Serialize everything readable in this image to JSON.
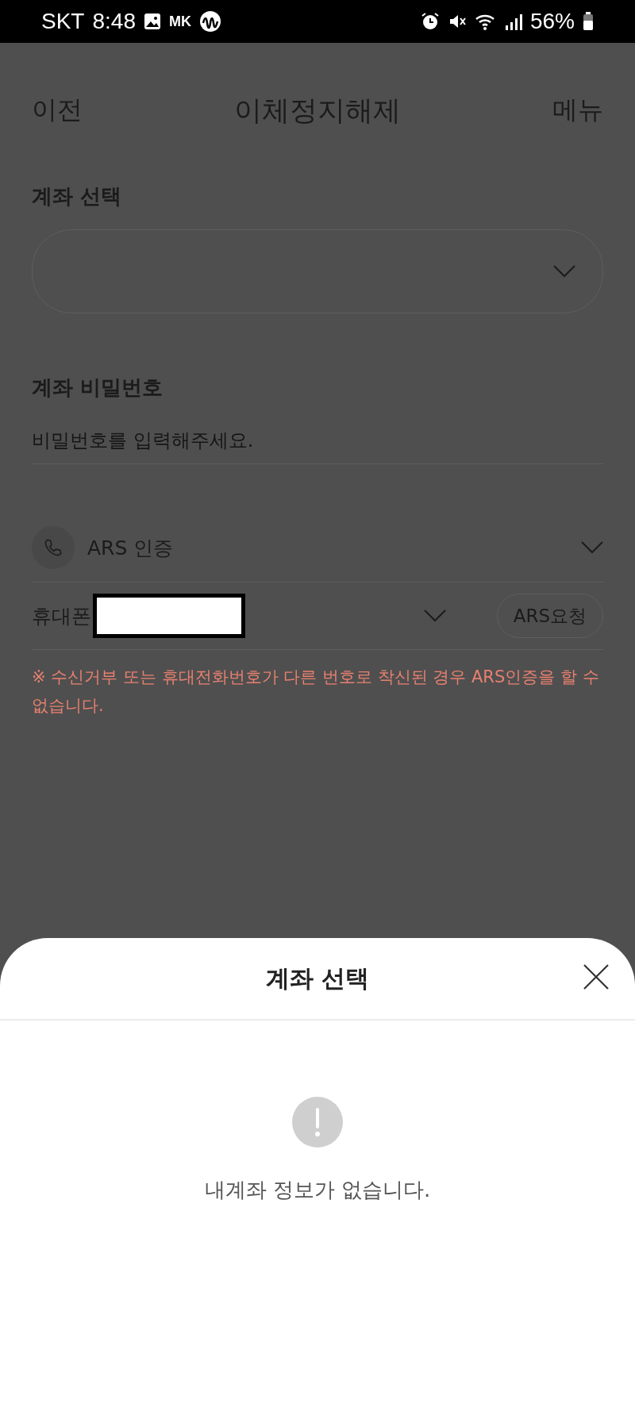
{
  "status_bar": {
    "carrier": "SKT",
    "time": "8:48",
    "notification_text": "MK",
    "battery": "56%"
  },
  "header": {
    "back": "이전",
    "title": "이체정지해제",
    "menu": "메뉴"
  },
  "form": {
    "account_label": "계좌 선택",
    "password_label": "계좌 비밀번호",
    "password_placeholder": "비밀번호를 입력해주세요.",
    "auth_method": "ARS 인증",
    "phone_label": "휴대폰",
    "ars_button": "ARS요청",
    "warning": "※ 수신거부 또는 휴대전화번호가 다른 번호로 착신된 경우 ARS인증을 할 수 없습니다."
  },
  "sheet": {
    "title": "계좌 선택",
    "message": "내계좌 정보가 없습니다."
  }
}
